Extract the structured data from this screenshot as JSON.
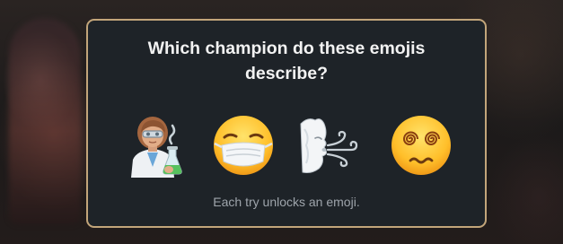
{
  "dialog": {
    "title": "Which champion do these emojis describe?",
    "hint": "Each try unlocks an emoji."
  },
  "emojis": [
    {
      "icon": "woman-scientist-icon"
    },
    {
      "icon": "face-with-medical-mask-icon"
    },
    {
      "icon": "wind-face-icon"
    },
    {
      "icon": "face-with-spiral-eyes-icon"
    }
  ],
  "colors": {
    "dialog_bg": "#1e2328",
    "border_gold": "#c2a57a",
    "title_text": "#f2f2f2",
    "hint_text": "#9ea4ab"
  }
}
